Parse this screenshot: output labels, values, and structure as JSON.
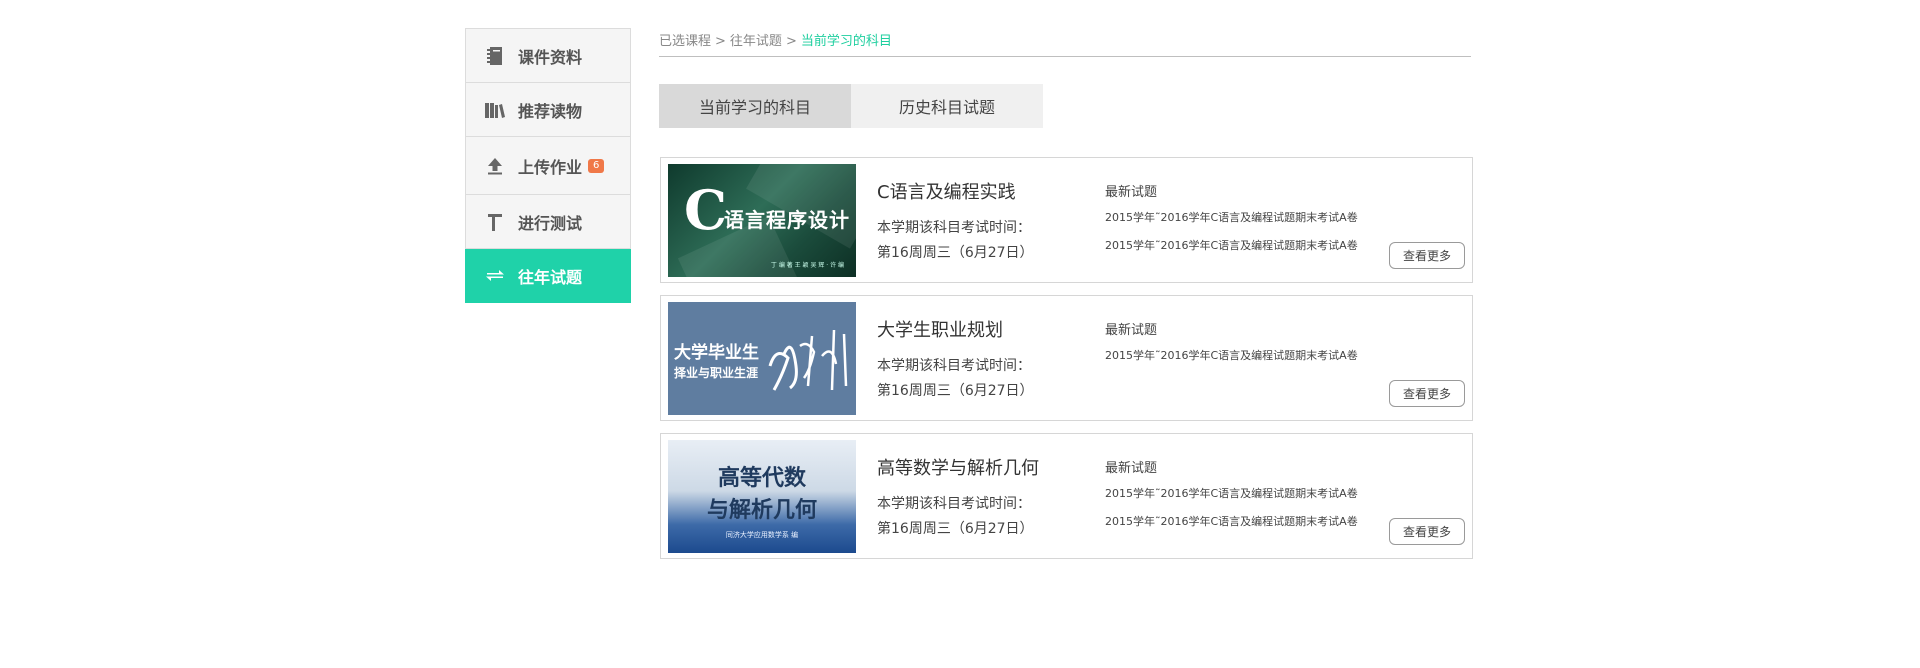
{
  "sidebar": {
    "items": [
      {
        "label": "课件资料",
        "icon": "book-icon"
      },
      {
        "label": "推荐读物",
        "icon": "books-icon"
      },
      {
        "label": "上传作业",
        "icon": "upload-icon",
        "badge": "6"
      },
      {
        "label": "进行测试",
        "icon": "test-icon"
      },
      {
        "label": "往年试题",
        "icon": "swap-icon",
        "active": true
      }
    ]
  },
  "breadcrumb": {
    "items": [
      "已选课程",
      "往年试题"
    ],
    "separator": ">",
    "current": "当前学习的科目"
  },
  "tabs": [
    {
      "label": "当前学习的科目",
      "active": true
    },
    {
      "label": "历史科目试题",
      "active": false
    }
  ],
  "courses": [
    {
      "title": "C语言及编程实践",
      "cover": {
        "big": "C",
        "sub": "语言程序设计",
        "tiny": "丁 编 著   王 颖   吴 辉 · 许 编"
      },
      "exam_label": "本学期该科目考试时间：",
      "exam_time": "第16周周三（6月27日）",
      "latest_label": "最新试题",
      "papers": [
        "2015学年˜2016学年C语言及编程试题期末考试A卷",
        "2015学年˜2016学年C语言及编程试题期末考试A卷"
      ],
      "more_label": "查看更多"
    },
    {
      "title": "大学生职业规划",
      "cover": {
        "line1": "大学毕业生",
        "line2": "择业与职业生涯"
      },
      "exam_label": "本学期该科目考试时间：",
      "exam_time": "第16周周三（6月27日）",
      "latest_label": "最新试题",
      "papers": [
        "2015学年˜2016学年C语言及编程试题期末考试A卷"
      ],
      "more_label": "查看更多"
    },
    {
      "title": "高等数学与解析几何",
      "cover": {
        "line1": "高等代数",
        "line2": "与解析几何",
        "tiny": "同济大学应用数学系  编"
      },
      "exam_label": "本学期该科目考试时间：",
      "exam_time": "第16周周三（6月27日）",
      "latest_label": "最新试题",
      "papers": [
        "2015学年˜2016学年C语言及编程试题期末考试A卷",
        "2015学年˜2016学年C语言及编程试题期末考试A卷"
      ],
      "more_label": "查看更多"
    }
  ],
  "colors": {
    "accent": "#1fd2a9",
    "badge": "#f07848",
    "current_crumb": "#1fcf9f"
  }
}
